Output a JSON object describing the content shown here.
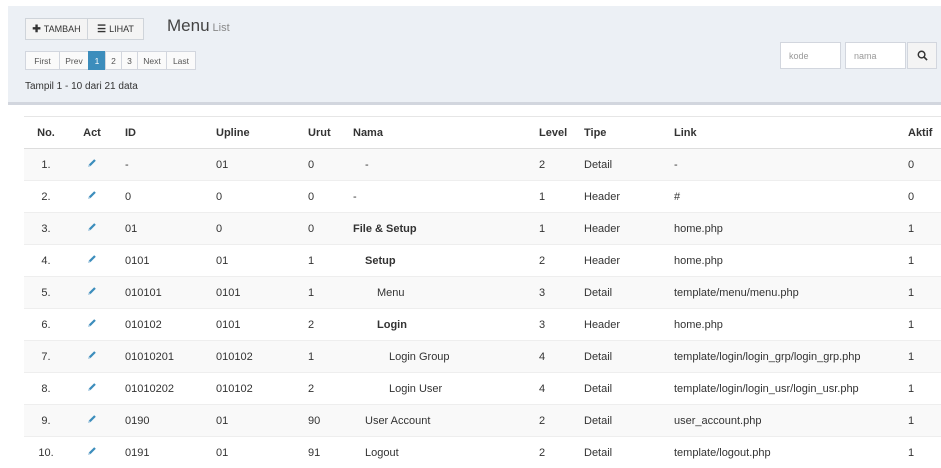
{
  "toolbar": {
    "add_label": "TAMBAH",
    "view_label": "LIHAT",
    "title": "Menu",
    "subtitle": "List"
  },
  "pager": {
    "first": "First",
    "prev": "Prev",
    "pages": [
      "1",
      "2",
      "3"
    ],
    "active_page": "1",
    "next": "Next",
    "last": "Last"
  },
  "info": "Tampil 1 - 10 dari 21 data",
  "search": {
    "kode_placeholder": "kode",
    "nama_placeholder": "nama"
  },
  "colors": {
    "accent": "#3c8dbc",
    "pencil": "#3c8dbc",
    "band": "#ecf0f5"
  },
  "table": {
    "headers": [
      "No.",
      "Act",
      "ID",
      "Upline",
      "Urut",
      "Nama",
      "Level",
      "Tipe",
      "Link",
      "Aktif"
    ],
    "rows": [
      {
        "no": "1.",
        "id": "-",
        "upline": "01",
        "urut": "0",
        "nama": "-",
        "indent": 1,
        "bold": false,
        "level": "2",
        "tipe": "Detail",
        "link": "-",
        "aktif": "0"
      },
      {
        "no": "2.",
        "id": "0",
        "upline": "0",
        "urut": "0",
        "nama": "-",
        "indent": 0,
        "bold": false,
        "level": "1",
        "tipe": "Header",
        "link": "#",
        "aktif": "0"
      },
      {
        "no": "3.",
        "id": "01",
        "upline": "0",
        "urut": "0",
        "nama": "File & Setup",
        "indent": 0,
        "bold": true,
        "level": "1",
        "tipe": "Header",
        "link": "home.php",
        "aktif": "1"
      },
      {
        "no": "4.",
        "id": "0101",
        "upline": "01",
        "urut": "1",
        "nama": "Setup",
        "indent": 1,
        "bold": true,
        "level": "2",
        "tipe": "Header",
        "link": "home.php",
        "aktif": "1"
      },
      {
        "no": "5.",
        "id": "010101",
        "upline": "0101",
        "urut": "1",
        "nama": "Menu",
        "indent": 2,
        "bold": false,
        "level": "3",
        "tipe": "Detail",
        "link": "template/menu/menu.php",
        "aktif": "1"
      },
      {
        "no": "6.",
        "id": "010102",
        "upline": "0101",
        "urut": "2",
        "nama": "Login",
        "indent": 2,
        "bold": true,
        "level": "3",
        "tipe": "Header",
        "link": "home.php",
        "aktif": "1"
      },
      {
        "no": "7.",
        "id": "01010201",
        "upline": "010102",
        "urut": "1",
        "nama": "Login Group",
        "indent": 3,
        "bold": false,
        "level": "4",
        "tipe": "Detail",
        "link": "template/login/login_grp/login_grp.php",
        "aktif": "1"
      },
      {
        "no": "8.",
        "id": "01010202",
        "upline": "010102",
        "urut": "2",
        "nama": "Login User",
        "indent": 3,
        "bold": false,
        "level": "4",
        "tipe": "Detail",
        "link": "template/login/login_usr/login_usr.php",
        "aktif": "1"
      },
      {
        "no": "9.",
        "id": "0190",
        "upline": "01",
        "urut": "90",
        "nama": "User Account",
        "indent": 1,
        "bold": false,
        "level": "2",
        "tipe": "Detail",
        "link": "user_account.php",
        "aktif": "1"
      },
      {
        "no": "10.",
        "id": "0191",
        "upline": "01",
        "urut": "91",
        "nama": "Logout",
        "indent": 1,
        "bold": false,
        "level": "2",
        "tipe": "Detail",
        "link": "template/logout.php",
        "aktif": "1"
      }
    ]
  }
}
